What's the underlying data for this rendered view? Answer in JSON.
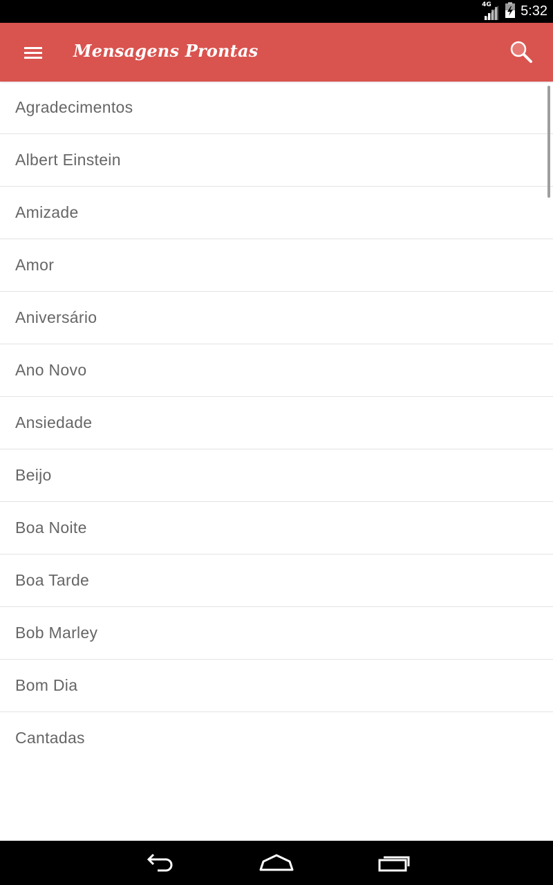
{
  "status_bar": {
    "network": "4G",
    "time": "5:32"
  },
  "app_bar": {
    "title": "Mensagens Prontas",
    "color": "#d9534f"
  },
  "categories": [
    "Agradecimentos",
    "Albert Einstein",
    "Amizade",
    "Amor",
    "Aniversário",
    "Ano Novo",
    "Ansiedade",
    "Beijo",
    "Boa Noite",
    "Boa Tarde",
    "Bob Marley",
    "Bom Dia",
    "Cantadas"
  ],
  "icons": {
    "menu": "menu-icon",
    "search": "search-icon",
    "back": "back-icon",
    "home": "home-icon",
    "recents": "recents-icon"
  }
}
